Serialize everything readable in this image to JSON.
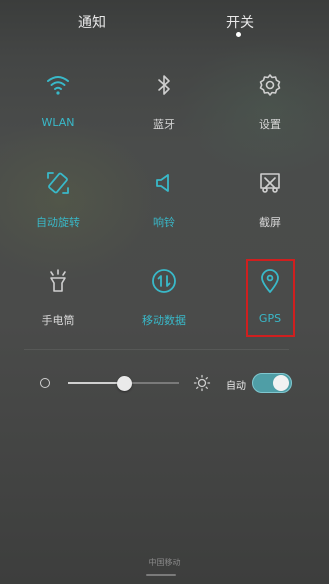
{
  "tabs": {
    "notifications": "通知",
    "switches": "开关",
    "active": "switches"
  },
  "colors": {
    "accent": "#39b9c9",
    "highlight_box": "#d01f1f",
    "inactive": "#d8d8d8"
  },
  "tiles": [
    {
      "id": "wlan",
      "label": "WLAN",
      "icon": "wifi-icon",
      "active": true
    },
    {
      "id": "bluetooth",
      "label": "蓝牙",
      "icon": "bluetooth-icon",
      "active": false
    },
    {
      "id": "settings",
      "label": "设置",
      "icon": "gear-icon",
      "active": false
    },
    {
      "id": "auto-rotate",
      "label": "自动旋转",
      "icon": "rotate-icon",
      "active": true
    },
    {
      "id": "ring",
      "label": "响铃",
      "icon": "speaker-icon",
      "active": true
    },
    {
      "id": "screenshot",
      "label": "截屏",
      "icon": "scissors-icon",
      "active": false
    },
    {
      "id": "flashlight",
      "label": "手电筒",
      "icon": "flashlight-icon",
      "active": false
    },
    {
      "id": "mobile-data",
      "label": "移动数据",
      "icon": "data-arrows-icon",
      "active": true
    },
    {
      "id": "gps",
      "label": "GPS",
      "icon": "location-pin-icon",
      "active": true
    }
  ],
  "brightness": {
    "level": 0.5,
    "auto_label": "自动",
    "auto_on": true
  },
  "footer": {
    "carrier": "中国移动"
  }
}
